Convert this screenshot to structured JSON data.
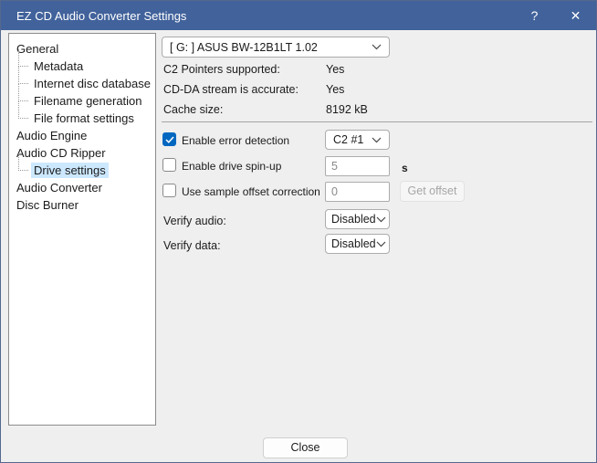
{
  "window": {
    "title": "EZ CD Audio Converter Settings",
    "help_button": "?",
    "close_button": "✕"
  },
  "sidebar": {
    "items": [
      {
        "label": "General",
        "level": 0,
        "selected": false
      },
      {
        "label": "Metadata",
        "level": 1,
        "selected": false
      },
      {
        "label": "Internet disc database",
        "level": 1,
        "selected": false
      },
      {
        "label": "Filename generation",
        "level": 1,
        "selected": false
      },
      {
        "label": "File format settings",
        "level": 1,
        "selected": false
      },
      {
        "label": "Audio Engine",
        "level": 0,
        "selected": false
      },
      {
        "label": "Audio CD Ripper",
        "level": 0,
        "selected": false
      },
      {
        "label": "Drive settings",
        "level": 1,
        "selected": true
      },
      {
        "label": "Audio Converter",
        "level": 0,
        "selected": false
      },
      {
        "label": "Disc Burner",
        "level": 0,
        "selected": false
      }
    ]
  },
  "main": {
    "drive_select": "[ G: ] ASUS BW-12B1LT 1.02",
    "info": [
      {
        "label": "C2 Pointers supported:",
        "value": "Yes"
      },
      {
        "label": "CD-DA stream is accurate:",
        "value": "Yes"
      },
      {
        "label": "Cache size:",
        "value": "8192 kB"
      }
    ],
    "error_detection": {
      "label": "Enable error detection",
      "checked": true,
      "mode": "C2 #1"
    },
    "drive_spin_up": {
      "label": "Enable drive spin-up",
      "checked": false,
      "value": "5",
      "unit": "s"
    },
    "sample_offset": {
      "label": "Use sample offset correction",
      "checked": false,
      "value": "0",
      "button": "Get offset"
    },
    "verify_audio": {
      "label": "Verify audio:",
      "value": "Disabled"
    },
    "verify_data": {
      "label": "Verify data:",
      "value": "Disabled"
    }
  },
  "footer": {
    "close": "Close"
  },
  "colors": {
    "titlebar": "#41629b",
    "accent": "#0067c0",
    "selection": "#cce8ff"
  }
}
